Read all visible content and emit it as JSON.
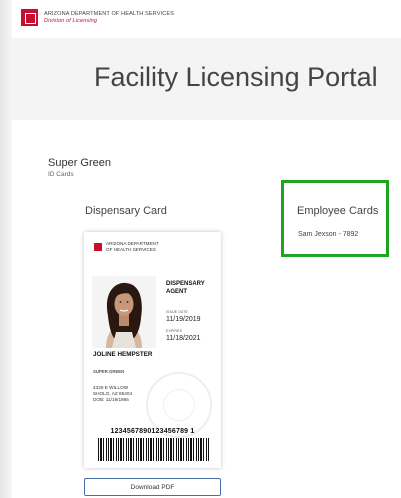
{
  "header": {
    "org_line1": "ARIZONA DEPARTMENT OF HEALTH SERVICES",
    "org_line2": "Division of Licensing",
    "logo_icon": "adhs-logo-icon"
  },
  "portal": {
    "title": "Facility Licensing Portal"
  },
  "business": {
    "name": "Super Green",
    "type": "ID Cards"
  },
  "dispensary": {
    "title": "Dispensary Card",
    "card": {
      "org_line1": "ARIZONA DEPARTMENT",
      "org_line2": "OF HEALTH SERVICES",
      "role_line1": "DISPENSARY",
      "role_line2": "AGENT",
      "issue_label": "ISSUE DATE",
      "issue_date": "11/19/2019",
      "expires_label": "EXPIRES",
      "expires_date": "11/18/2021",
      "holder_name": "JOLINE HEMPSTER",
      "company": "SUPER GREEN",
      "address_line1": "4326 E WILLOW",
      "address_line2": "SHOLO, AZ 85404",
      "dob": "DOB: 11/19/1965",
      "barcode_number": "1234567890123456789 1"
    },
    "download_label": "Download PDF"
  },
  "employees": {
    "title": "Employee Cards",
    "items": [
      "Sam Jexson - 7892"
    ]
  },
  "colors": {
    "brand_red": "#c8102e",
    "highlight_green": "#1fa51f",
    "button_border": "#4a6fa5"
  }
}
